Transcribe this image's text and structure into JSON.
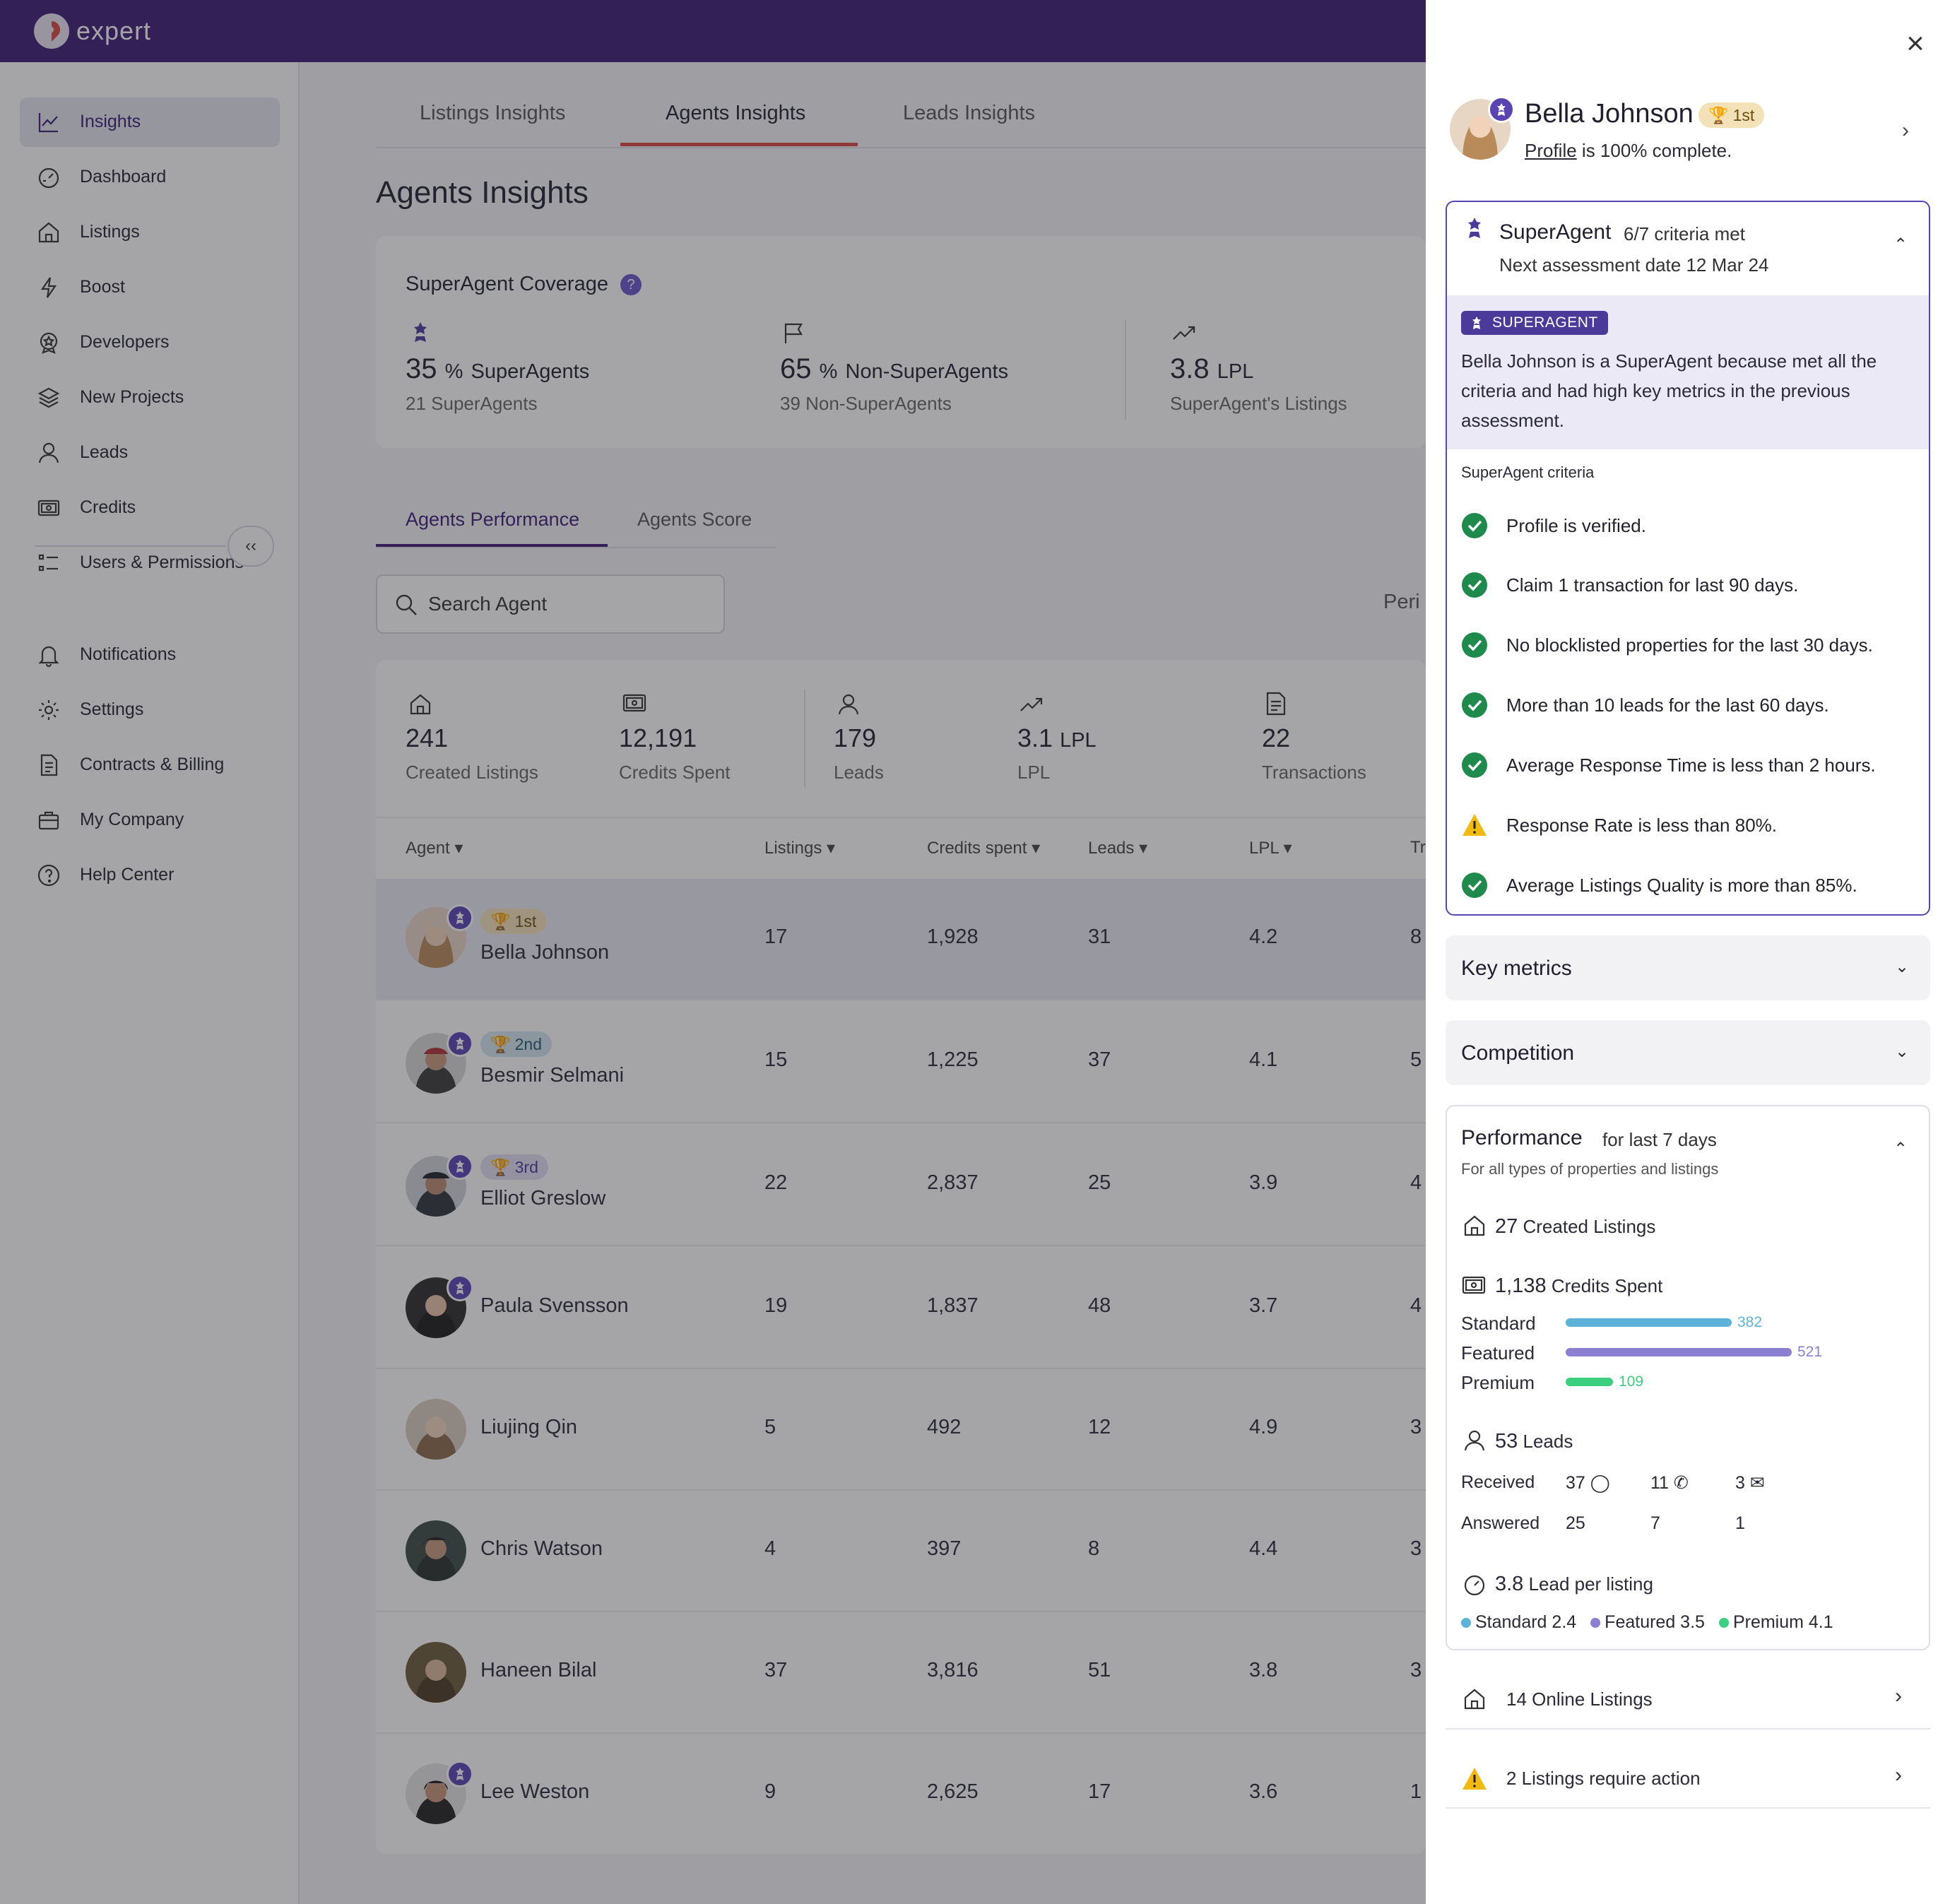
{
  "app": {
    "logo_text": "expert",
    "brand_color": "#3a1b74",
    "accent_color": "#d9463f"
  },
  "sidebar": {
    "items": [
      {
        "label": "Insights",
        "icon": "chart-line-icon",
        "active": true
      },
      {
        "label": "Dashboard",
        "icon": "gauge-icon"
      },
      {
        "label": "Listings",
        "icon": "house-icon"
      },
      {
        "label": "Boost",
        "icon": "lightning-icon"
      },
      {
        "label": "Developers",
        "icon": "badge-icon"
      },
      {
        "label": "New Projects",
        "icon": "layers-icon"
      },
      {
        "label": "Leads",
        "icon": "user-icon"
      },
      {
        "label": "Credits",
        "icon": "banknote-icon"
      },
      {
        "label": "Users & Permissions",
        "icon": "list-icon"
      }
    ],
    "secondary": [
      {
        "label": "Notifications",
        "icon": "bell-icon"
      },
      {
        "label": "Settings",
        "icon": "gear-icon"
      },
      {
        "label": "Contracts & Billing",
        "icon": "document-icon"
      },
      {
        "label": "My Company",
        "icon": "briefcase-icon"
      },
      {
        "label": "Help Center",
        "icon": "question-icon"
      }
    ],
    "collapse_label": "‹‹"
  },
  "tabs": [
    "Listings Insights",
    "Agents Insights",
    "Leads Insights"
  ],
  "page_title": "Agents Insights",
  "coverage": {
    "title": "SuperAgent Coverage",
    "help": "?",
    "stats": [
      {
        "value": "35",
        "unit": "%",
        "label": "SuperAgents",
        "sub": "21 SuperAgents"
      },
      {
        "value": "65",
        "unit": "%",
        "label": "Non-SuperAgents",
        "sub": "39 Non-SuperAgents"
      },
      {
        "value": "3.8",
        "unit": "LPL",
        "label": "",
        "sub": "SuperAgent's Listings"
      }
    ]
  },
  "subtabs": [
    "Agents Performance",
    "Agents Score"
  ],
  "search": {
    "placeholder": "Search Agent"
  },
  "period_label": "Peri",
  "summary": [
    {
      "value": "241",
      "unit": "",
      "label": "Created Listings"
    },
    {
      "value": "12,191",
      "unit": "",
      "label": "Credits Spent"
    },
    {
      "value": "179",
      "unit": "",
      "label": "Leads"
    },
    {
      "value": "3.1",
      "unit": "LPL",
      "label": "LPL"
    },
    {
      "value": "22",
      "unit": "",
      "label": "Transactions"
    }
  ],
  "table": {
    "headers": [
      "Agent",
      "Listings",
      "Credits spent",
      "Leads",
      "LPL",
      "Tr"
    ],
    "rows": [
      {
        "name": "Bella Johnson",
        "rank": "1st",
        "super": true,
        "listings": "17",
        "credits": "1,928",
        "leads": "31",
        "lpl": "4.2",
        "tr": "8"
      },
      {
        "name": "Besmir Selmani",
        "rank": "2nd",
        "super": true,
        "listings": "15",
        "credits": "1,225",
        "leads": "37",
        "lpl": "4.1",
        "tr": "5"
      },
      {
        "name": "Elliot Greslow",
        "rank": "3rd",
        "super": true,
        "listings": "22",
        "credits": "2,837",
        "leads": "25",
        "lpl": "3.9",
        "tr": "4"
      },
      {
        "name": "Paula Svensson",
        "rank": "",
        "super": true,
        "listings": "19",
        "credits": "1,837",
        "leads": "48",
        "lpl": "3.7",
        "tr": "4"
      },
      {
        "name": "Liujing Qin",
        "rank": "",
        "super": false,
        "listings": "5",
        "credits": "492",
        "leads": "12",
        "lpl": "4.9",
        "tr": "3"
      },
      {
        "name": "Chris Watson",
        "rank": "",
        "super": false,
        "listings": "4",
        "credits": "397",
        "leads": "8",
        "lpl": "4.4",
        "tr": "3"
      },
      {
        "name": "Haneen Bilal",
        "rank": "",
        "super": false,
        "listings": "37",
        "credits": "3,816",
        "leads": "51",
        "lpl": "3.8",
        "tr": "3"
      },
      {
        "name": "Lee Weston",
        "rank": "",
        "super": true,
        "listings": "9",
        "credits": "2,625",
        "leads": "17",
        "lpl": "3.6",
        "tr": "1"
      }
    ]
  },
  "panel": {
    "close": "×",
    "name": "Bella Johnson",
    "rank": "1st",
    "profile_link": "Profile",
    "profile_rest": " is 100% complete.",
    "superagent": {
      "title": "SuperAgent",
      "criteria_met": "6/7 criteria met",
      "next_assessment": "Next assessment date 12 Mar 24",
      "badge": "SUPERAGENT",
      "description": "Bella Johnson is a SuperAgent because met all the criteria and had high key metrics in the previous assessment.",
      "criteria_title": "SuperAgent criteria",
      "criteria": [
        {
          "text": "Profile is verified.",
          "ok": true
        },
        {
          "text": "Claim 1 transaction for last 90 days.",
          "ok": true
        },
        {
          "text": "No blocklisted properties for the last 30 days.",
          "ok": true
        },
        {
          "text": "More than 10 leads for the last 60 days.",
          "ok": true
        },
        {
          "text": "Average Response Time is less than 2 hours.",
          "ok": true
        },
        {
          "text": "Response Rate is less than 80%.",
          "ok": false
        },
        {
          "text": "Average Listings Quality is more than 85%.",
          "ok": true
        }
      ]
    },
    "key_metrics": "Key metrics",
    "competition": "Competition",
    "performance": {
      "title": "Performance",
      "period": "for last 7 days",
      "subtitle": "For all types of properties and listings",
      "created_value": "27",
      "created_label": "Created Listings",
      "credits_value": "1,138",
      "credits_label": "Credits Spent",
      "credit_bars": [
        {
          "label": "Standard",
          "value": 382,
          "value_text": "382",
          "color": "#5bb3d9"
        },
        {
          "label": "Featured",
          "value": 521,
          "value_text": "521",
          "color": "#8a7fd0"
        },
        {
          "label": "Premium",
          "value": 109,
          "value_text": "109",
          "color": "#3ccf7f"
        }
      ],
      "leads_value": "53",
      "leads_label": "Leads",
      "received_label": "Received",
      "received": [
        "37",
        "11",
        "3"
      ],
      "answered_label": "Answered",
      "answered": [
        "25",
        "7",
        "1"
      ],
      "lpl_value": "3.8",
      "lpl_label": "Lead per listing",
      "lpl_breakdown": [
        {
          "label": "Standard 2.4",
          "color": "#5bb3d9"
        },
        {
          "label": "Featured 3.5",
          "color": "#8a7fd0"
        },
        {
          "label": "Premium 4.1",
          "color": "#3ccf7f"
        }
      ]
    },
    "online_listings": "14 Online Listings",
    "listings_action": "2 Listings require action"
  }
}
